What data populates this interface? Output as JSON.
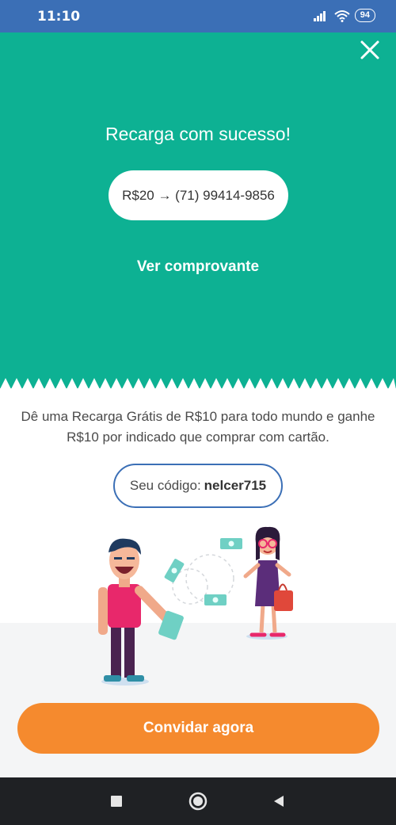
{
  "status_bar": {
    "time": "11:10",
    "battery": "94"
  },
  "hero": {
    "title": "Recarga com sucesso!",
    "recharge_summary": "R$20 → (71) 99414-9856",
    "receipt_link": "Ver comprovante"
  },
  "promo": {
    "text": "Dê uma Recarga Grátis de R$10 para todo mundo e ganhe R$10 por indicado que comprar com cartão.",
    "code_label": "Seu código:",
    "code_value": "nelcer715"
  },
  "invite_button": "Convidar agora",
  "icons": {
    "close": "close-icon",
    "signal": "signal-icon",
    "wifi": "wifi-icon",
    "battery": "battery-icon",
    "nav_recent": "recent-apps-icon",
    "nav_home": "home-icon",
    "nav_back": "back-icon"
  },
  "colors": {
    "status_bar": "#3b6fb6",
    "hero": "#0db193",
    "accent_orange": "#f58a2e",
    "code_border": "#3b6fb6",
    "nav_bar": "#1f2124"
  }
}
